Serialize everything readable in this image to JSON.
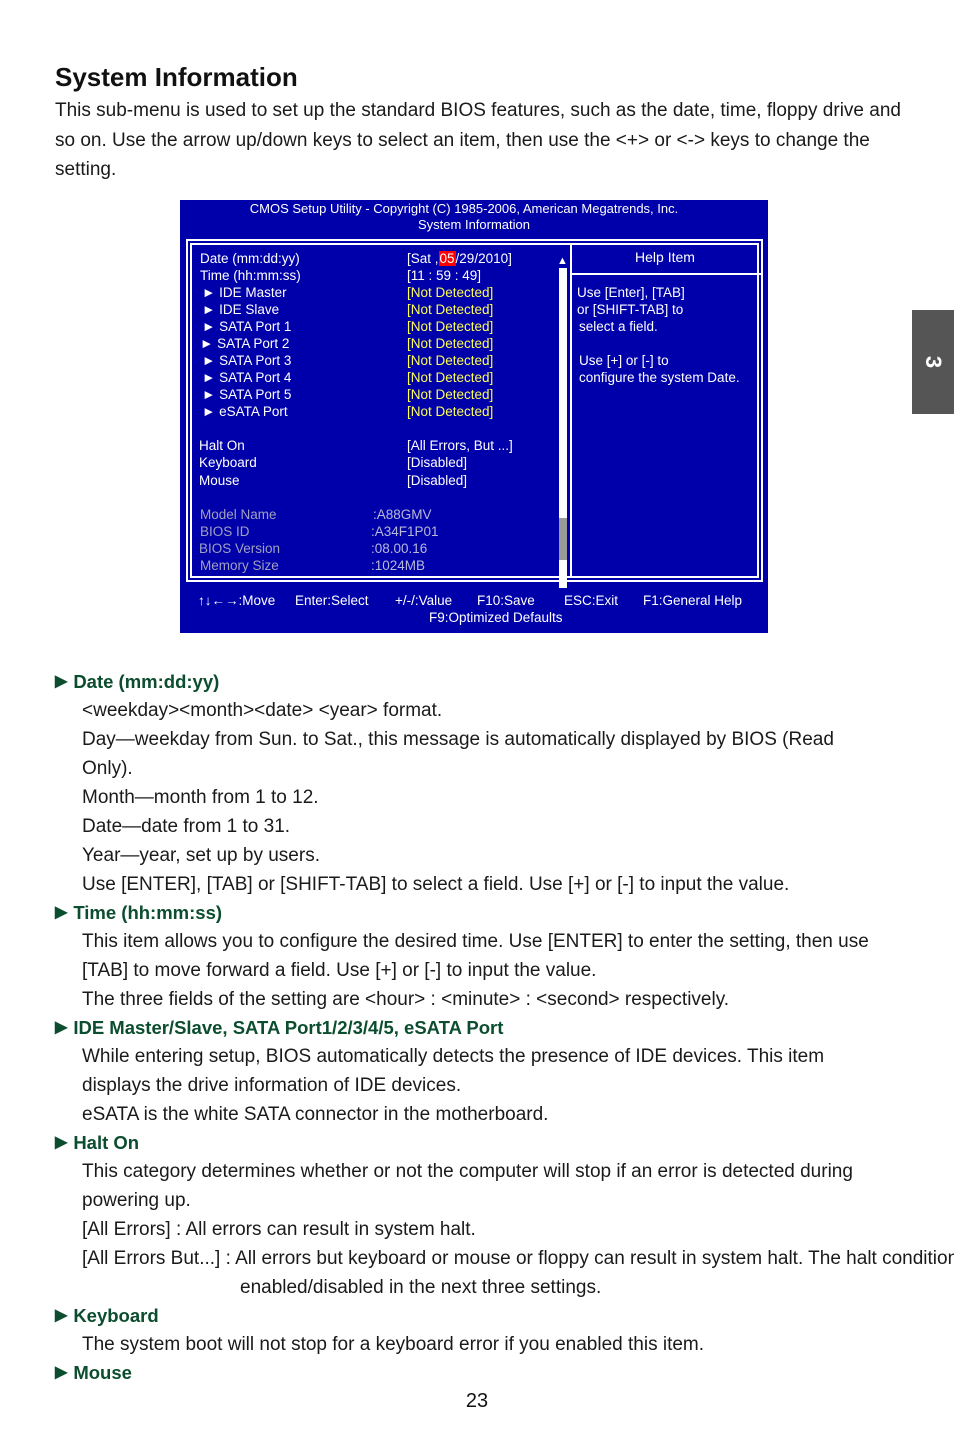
{
  "page": {
    "title": "System Information",
    "intro": "This sub-menu is used to set up the standard BIOS features, such as the date, time, floppy drive and so on. Use the arrow up/down keys to select an item, then use the <+> or <-> keys to change the setting.",
    "chapter_tab": "3",
    "page_number": "23"
  },
  "bios": {
    "header_line1": "CMOS Setup Utility - Copyright (C) 1985-2006, American Megatrends, Inc.",
    "header_line2": "System Information",
    "colors": {
      "background": "#0000aa",
      "value_yellow": "#ffff55",
      "highlight": "#ff0000",
      "info_gray": "#a0a0c8"
    },
    "date": {
      "label": "Date (mm:dd:yy)",
      "prefix": "[Sat ,",
      "month": "05",
      "suffix": "/29/2010]"
    },
    "time": {
      "label": "Time (hh:mm:ss)",
      "value": "[11 : 59 : 49]"
    },
    "devices": [
      {
        "label": "► IDE Master",
        "value": "[Not Detected]"
      },
      {
        "label": "► IDE Slave",
        "value": "[Not Detected]"
      },
      {
        "label": "► SATA Port 1",
        "value": "[Not Detected]"
      },
      {
        "label": "► SATA Port 2",
        "value": "[Not Detected]"
      },
      {
        "label": "► SATA Port 3",
        "value": "[Not Detected]"
      },
      {
        "label": "► SATA Port 4",
        "value": "[Not Detected]"
      },
      {
        "label": "► SATA Port 5",
        "value": "[Not Detected]"
      },
      {
        "label": "► eSATA Port",
        "value": "[Not Detected]"
      }
    ],
    "settings": [
      {
        "label": "Halt On",
        "value": "[All Errors, But ...]"
      },
      {
        "label": "Keyboard",
        "value": "[Disabled]"
      },
      {
        "label": "Mouse",
        "value": "[Disabled]"
      }
    ],
    "info": [
      {
        "label": "Model Name",
        "value": ":A88GMV"
      },
      {
        "label": "BIOS ID",
        "value": ":A34F1P01"
      },
      {
        "label": "BIOS Version",
        "value": ":08.00.16"
      },
      {
        "label": "Memory Size",
        "value": ":1024MB"
      }
    ],
    "help": {
      "title": "Help Item",
      "lines_a": [
        "Use [Enter], [TAB]",
        "or [SHIFT-TAB] to",
        "select a field."
      ],
      "lines_b": [
        "Use [+] or [-] to",
        "configure the system Date."
      ]
    },
    "scrollbar": {
      "up_icon": "▲",
      "down_icon": "▼",
      "position_fraction": 0.85
    },
    "footer": {
      "move": "↑↓←→:Move",
      "select": "Enter:Select",
      "value": "+/-/:Value",
      "save": "F10:Save",
      "exit": "ESC:Exit",
      "help": "F1:General Help",
      "defaults": "F9:Optimized Defaults"
    }
  },
  "sections": {
    "arrow_icon": "▶",
    "heading_color": "#0b4d2e",
    "date": {
      "heading": "Date (mm:dd:yy)",
      "p1": "<weekday><month><date> <year> format.",
      "p2": "Day—weekday from Sun. to Sat., this message is automatically displayed by BIOS (Read Only).",
      "p3": "Month—month from 1 to 12.",
      "p4": "Date—date from 1 to 31.",
      "p5": "Year—year, set up by users.",
      "p6": "Use [ENTER], [TAB] or [SHIFT-TAB] to select a field. Use [+] or [-] to input the value."
    },
    "time": {
      "heading": "Time (hh:mm:ss)",
      "p1": "This item allows you to configure the desired time. Use [ENTER] to enter the setting, then use [TAB] to move forward a field. Use [+] or [-] to input the value.",
      "p2": "The three fields of the setting are <hour> : <minute> : <second> respectively."
    },
    "ide": {
      "heading": "IDE Master/Slave, SATA Port1/2/3/4/5, eSATA Port",
      "p1": "While entering setup, BIOS automatically detects the presence of IDE devices. This item displays the drive information of IDE devices.",
      "p2": "eSATA is the white SATA connector in the motherboard."
    },
    "halt": {
      "heading": "Halt On",
      "p1": "This category determines whether or not the computer will stop if an error is detected during powering up.",
      "p2": "[All Errors] : All errors can result in system halt.",
      "p3": "[All Errors But...] : All errors but keyboard or mouse or floppy can result in system halt. The halt condition can be enabled/disabled in the next three settings."
    },
    "keyboard": {
      "heading": "Keyboard",
      "p1": "The system boot will not stop for a keyboard error if you enabled this item."
    },
    "mouse": {
      "heading": "Mouse"
    }
  }
}
